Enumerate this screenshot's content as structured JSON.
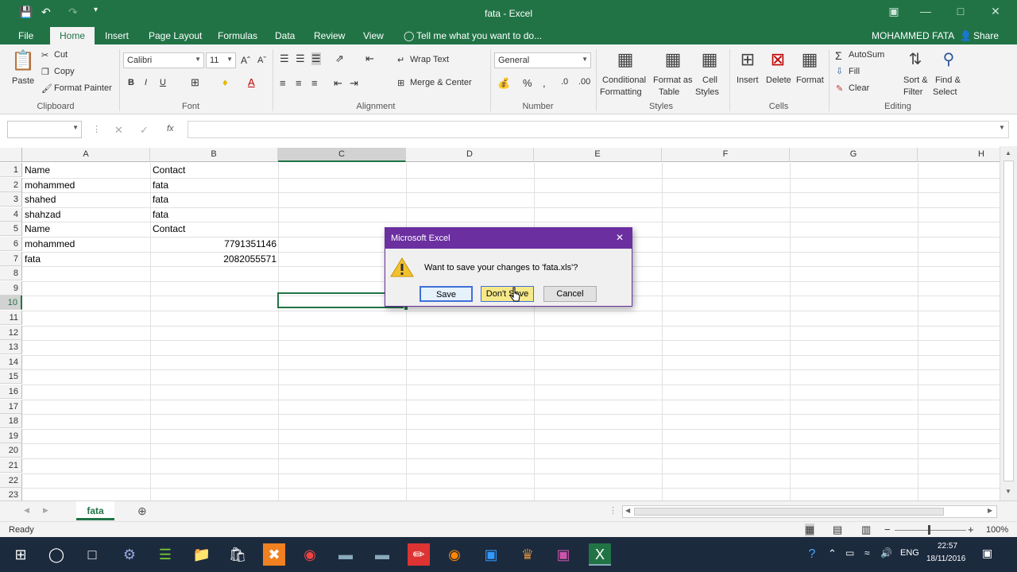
{
  "window": {
    "title": "fata - Excel",
    "user": "MOHAMMED FATA",
    "share": "Share"
  },
  "tabs": [
    "File",
    "Home",
    "Insert",
    "Page Layout",
    "Formulas",
    "Data",
    "Review",
    "View"
  ],
  "tell_me": "Tell me what you want to do...",
  "ribbon": {
    "clipboard": {
      "paste": "Paste",
      "cut": "Cut",
      "copy": "Copy",
      "format_painter": "Format Painter",
      "label": "Clipboard"
    },
    "font": {
      "name": "Calibri",
      "size": "11",
      "label": "Font"
    },
    "alignment": {
      "wrap": "Wrap Text",
      "merge": "Merge & Center",
      "label": "Alignment"
    },
    "number": {
      "format": "General",
      "label": "Number"
    },
    "styles": {
      "conditional": "Conditional",
      "formatting": "Formatting",
      "format_as": "Format as",
      "table": "Table",
      "cell": "Cell",
      "styles_txt": "Styles",
      "label": "Styles"
    },
    "cells": {
      "insert": "Insert",
      "delete": "Delete",
      "format": "Format",
      "label": "Cells"
    },
    "editing": {
      "autosum": "AutoSum",
      "fill": "Fill",
      "clear": "Clear",
      "sort": "Sort &",
      "filter": "Filter",
      "find": "Find &",
      "select": "Select",
      "label": "Editing"
    }
  },
  "columns": [
    "A",
    "B",
    "C",
    "D",
    "E",
    "F",
    "G",
    "H"
  ],
  "rows": [
    "1",
    "2",
    "3",
    "4",
    "5",
    "6",
    "7",
    "8",
    "9",
    "10",
    "11",
    "12",
    "13",
    "14",
    "15",
    "16",
    "17",
    "18",
    "19",
    "20",
    "21",
    "22",
    "23"
  ],
  "cells": {
    "A1": "Name",
    "B1": "Contact",
    "A2": "mohammed",
    "B2": "fata",
    "A3": "shahed",
    "B3": "fata",
    "A4": "shahzad",
    "B4": "fata",
    "A5": "Name",
    "B5": "Contact",
    "A6": "mohammed",
    "B6": "7791351146",
    "A7": "fata",
    "B7": "2082055571"
  },
  "sheet_tab": "fata",
  "status": {
    "ready": "Ready",
    "zoom": "100%"
  },
  "dialog": {
    "title": "Microsoft Excel",
    "message": "Want to save your changes to 'fata.xls'?",
    "save": "Save",
    "dont_save": "Don't Save",
    "cancel": "Cancel"
  },
  "taskbar": {
    "lang": "ENG",
    "time": "22:57",
    "date": "18/11/2016"
  }
}
